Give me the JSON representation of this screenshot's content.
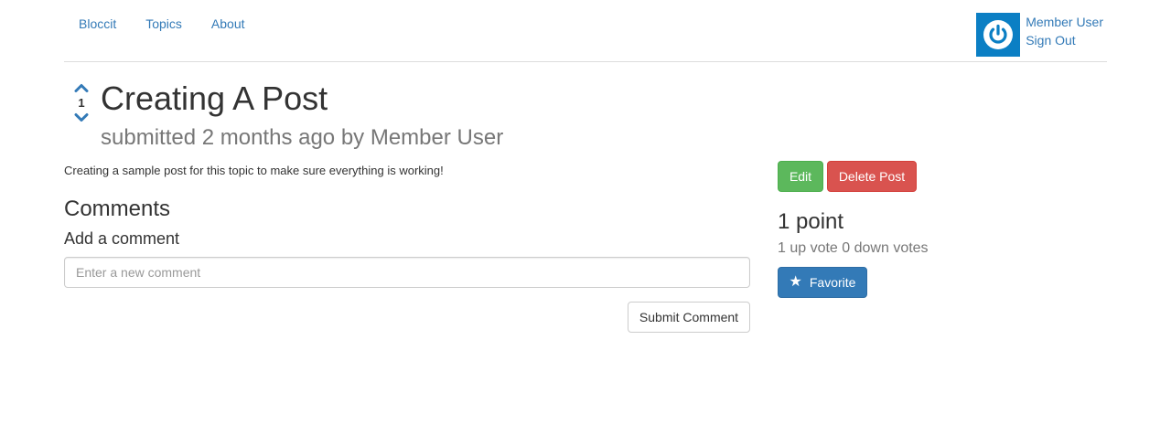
{
  "nav": {
    "links": [
      "Bloccit",
      "Topics",
      "About"
    ]
  },
  "user": {
    "name": "Member User",
    "sign_out": "Sign Out",
    "avatar_icon": "power-icon",
    "avatar_color": "#0b7fc4"
  },
  "post": {
    "vote_count": "1",
    "title": "Creating A Post",
    "meta": "submitted 2 months ago by Member User",
    "body": "Creating a sample post for this topic to make sure everything is working!"
  },
  "comments": {
    "heading": "Comments",
    "add_label": "Add a comment",
    "placeholder": "Enter a new comment",
    "submit_label": "Submit Comment"
  },
  "sidebar": {
    "edit_label": "Edit",
    "delete_label": "Delete Post",
    "points": "1 point",
    "vote_breakdown": "1 up vote 0 down votes",
    "favorite_label": "Favorite",
    "favorite_icon": "star-icon"
  },
  "colors": {
    "link": "#337ab7",
    "success": "#5cb85c",
    "danger": "#d9534f",
    "primary": "#337ab7",
    "muted": "#777777"
  }
}
